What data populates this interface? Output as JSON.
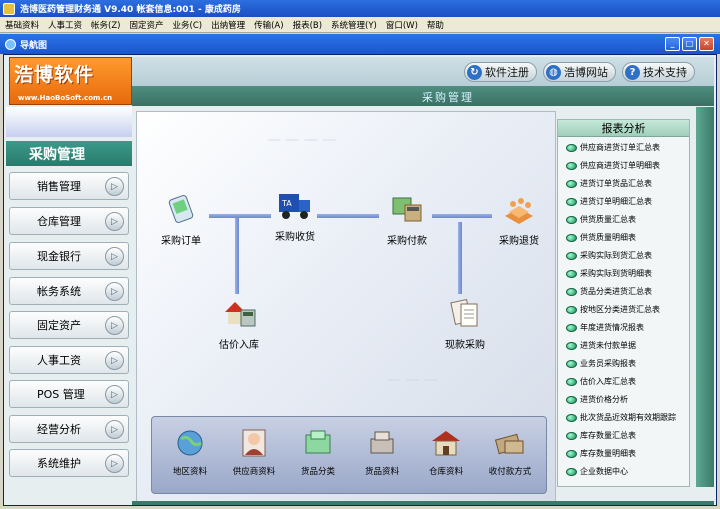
{
  "title_bar": "浩博医药管理财务通 V9.40 帐套信息:001 - 康成药房",
  "menu": [
    "基础资料",
    "人事工资",
    "帐务(Z)",
    "固定资产",
    "业务(C)",
    "出纳管理",
    "传输(A)",
    "报表(B)",
    "系统管理(Y)",
    "窗口(W)",
    "帮助"
  ],
  "child_window": {
    "title": "导航图"
  },
  "logo": {
    "text": "浩博软件",
    "site": "www.HaoBoSoft.com.cn"
  },
  "top_buttons": [
    {
      "label": "软件注册",
      "icon": "refresh-icon"
    },
    {
      "label": "浩博网站",
      "icon": "globe-icon"
    },
    {
      "label": "技术支持",
      "icon": "help-icon"
    }
  ],
  "section_title": "采购管理",
  "sidebar": {
    "current": "采购管理",
    "items": [
      "销售管理",
      "仓库管理",
      "现金银行",
      "帐务系统",
      "固定资产",
      "人事工资",
      "POS 管理",
      "经营分析",
      "系统维护"
    ]
  },
  "flow": {
    "order": "采购订单",
    "receive": "采购收货",
    "pay": "采购付款",
    "return": "采购退货",
    "estimate": "估价入库",
    "cash": "现款采购",
    "truck_label": "TA"
  },
  "tray": [
    "地区资料",
    "供应商资料",
    "货品分类",
    "货品资料",
    "仓库资料",
    "收付款方式"
  ],
  "report": {
    "title": "报表分析",
    "items": [
      "供应商进货订单汇总表",
      "供应商进货订单明细表",
      "进货订单货品汇总表",
      "进货订单明细汇总表",
      "供货质量汇总表",
      "供货质量明细表",
      "采购实际到货汇总表",
      "采购实际到货明细表",
      "货品分类进货汇总表",
      "按地区分类进货汇总表",
      "年度进货情况报表",
      "进货未付款单据",
      "业务员采购报表",
      "估价入库汇总表",
      "进货价格分析",
      "批次货品近效期有效期跟踪",
      "库存数量汇总表",
      "库存数量明细表",
      "企业数据中心"
    ]
  }
}
